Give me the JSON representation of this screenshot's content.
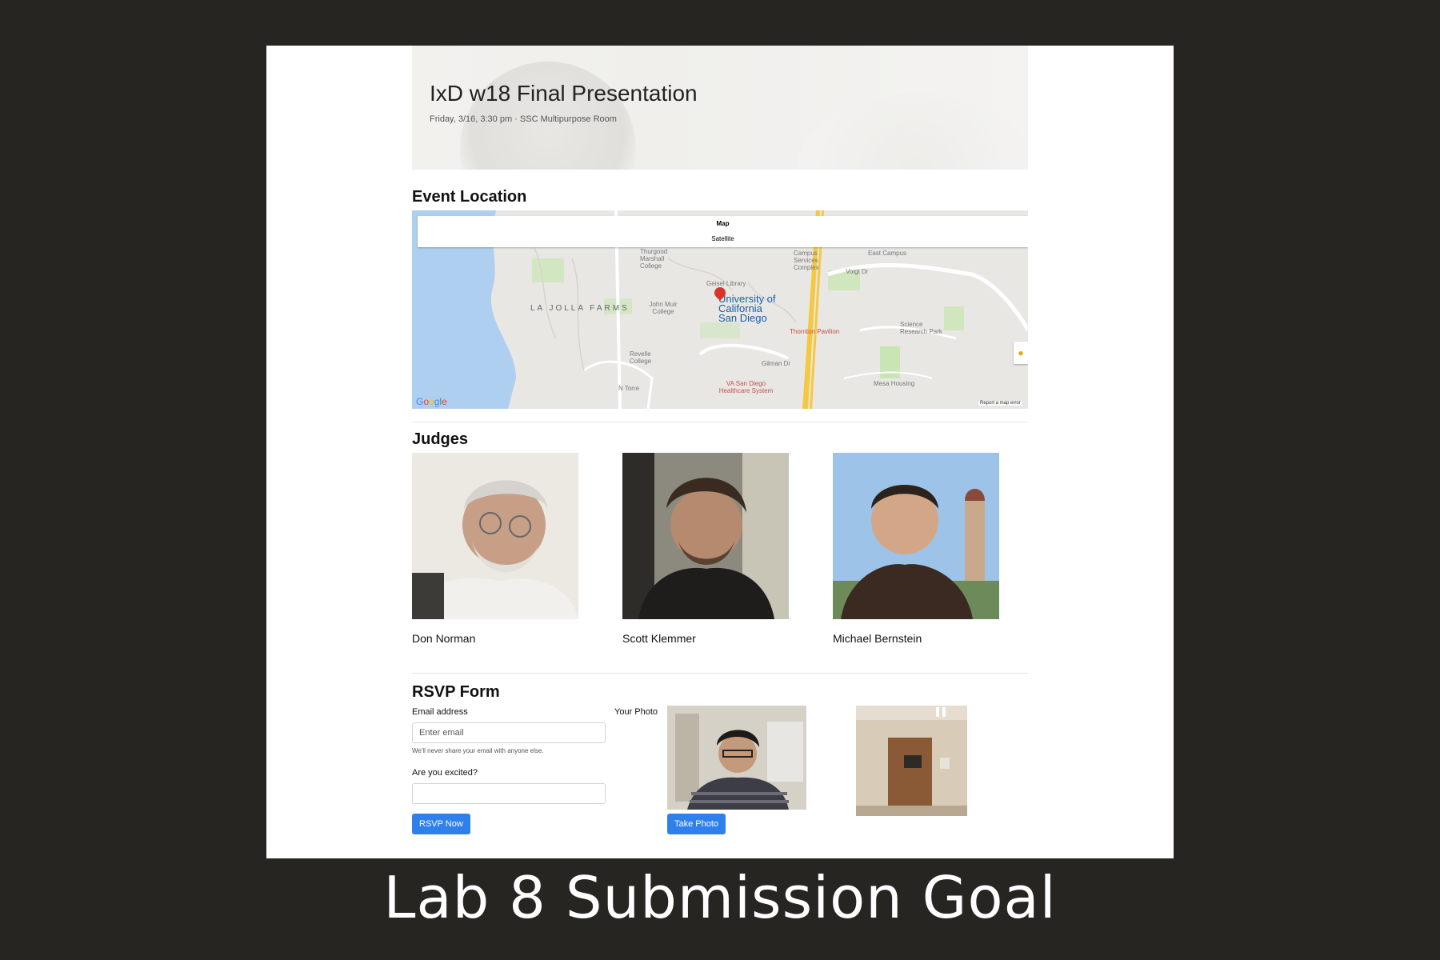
{
  "header": {
    "title": "IxD w18 Final Presentation",
    "subtitle": "Friday, 3/16, 3:30 pm · SSC Multipurpose Room"
  },
  "event_location": {
    "heading": "Event Location",
    "map_type_options": [
      "Map",
      "Satellite"
    ],
    "map_labels": {
      "thurgood": "Thurgood Marshall College",
      "campus_services": "Campus Services Complex",
      "east_campus": "East Campus",
      "geisel": "Geisel Library",
      "ucsd": "University of California San Diego",
      "la_jolla_farms": "LA JOLLA FARMS",
      "john_muir": "John Muir College",
      "voigt": "Voigt Dr",
      "thornton": "Thornton Pavilion",
      "science_park": "Science Research Park",
      "revelle": "Revelle College",
      "gilman": "Gilman Dr",
      "va_san_diego": "VA San Diego Healthcare System",
      "mesa_housing": "Mesa Housing",
      "n_torrey": "N Torre"
    },
    "google_logo": "Google",
    "report_link": "Report a map error",
    "pegman_icon": "pegman-icon",
    "marker_icon": "map-marker-icon"
  },
  "judges": {
    "heading": "Judges",
    "people": [
      {
        "name": "Don Norman"
      },
      {
        "name": "Scott Klemmer"
      },
      {
        "name": "Michael Bernstein"
      }
    ]
  },
  "rsvp": {
    "heading": "RSVP Form",
    "email_label": "Email address",
    "email_placeholder": "Enter email",
    "email_help": "We'll never share your email with anyone else.",
    "excited_label": "Are you excited?",
    "excited_value": "",
    "submit_label": "RSVP Now",
    "photo_label": "Your Photo",
    "take_photo_label": "Take Photo"
  },
  "slide": {
    "caption": "Lab 8 Submission Goal"
  },
  "colors": {
    "slide_background": "#262521",
    "accent_button": "#2f80ed",
    "map_water": "#aecff0",
    "map_park": "#c8e6b4"
  }
}
